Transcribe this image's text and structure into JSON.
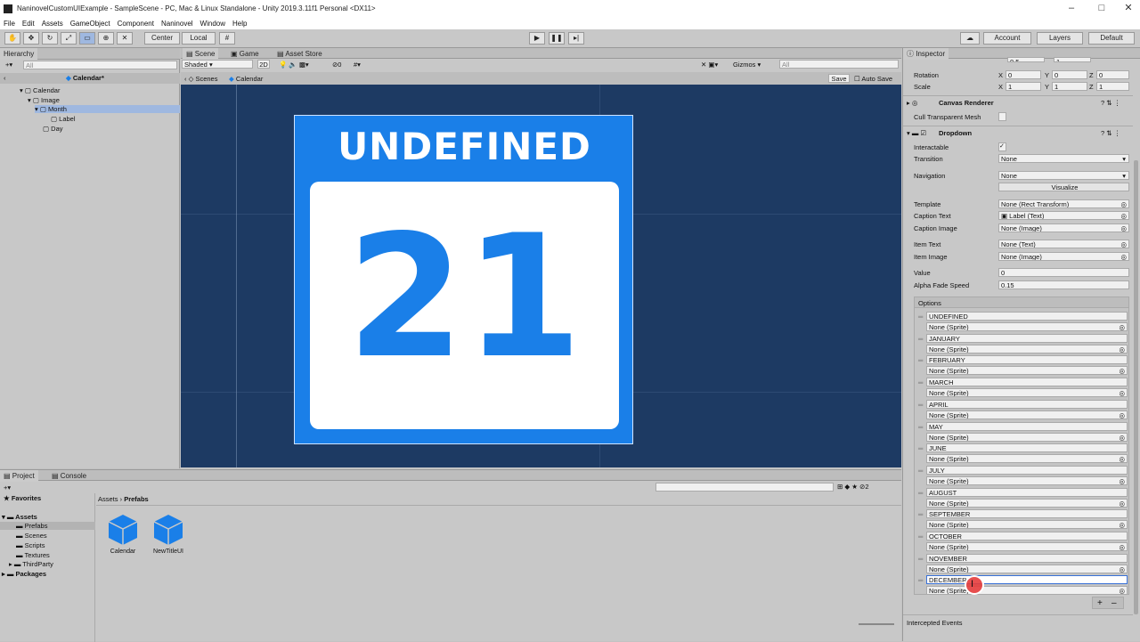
{
  "window": {
    "title": "NaninovelCustomUIExample - SampleScene - PC, Mac & Linux Standalone - Unity 2019.3.11f1 Personal <DX11>",
    "min": "–",
    "max": "□",
    "close": "✕"
  },
  "menu": [
    "File",
    "Edit",
    "Assets",
    "GameObject",
    "Component",
    "Naninovel",
    "Window",
    "Help"
  ],
  "toolbar": {
    "center": "Center",
    "local": "Local",
    "account": "Account",
    "layers": "Layers",
    "layout": "Default"
  },
  "hierarchy": {
    "tab": "Hierarchy",
    "search_placeholder": "All",
    "breadcrumb": "Calendar*",
    "items": [
      "Calendar",
      "Image",
      "Month",
      "Label",
      "Day"
    ]
  },
  "scene": {
    "tabs": [
      "Scene",
      "Game",
      "Asset Store"
    ],
    "shading": "Shaded",
    "mode2d": "2D",
    "gizmos": "Gizmos",
    "search_placeholder": "All",
    "hidden_count": "0",
    "crumb_scenes": "Scenes",
    "crumb_prefab": "Calendar",
    "save": "Save",
    "autosave": "Auto Save",
    "month": "UNDEFINED",
    "day": "21"
  },
  "project": {
    "tabs": [
      "Project",
      "Console"
    ],
    "favorites": "Favorites",
    "assets": "Assets",
    "folders": [
      "Prefabs",
      "Scenes",
      "Scripts",
      "Textures",
      "ThirdParty"
    ],
    "packages": "Packages",
    "path_root": "Assets",
    "path_leaf": "Prefabs",
    "hidden_count": "2",
    "files": [
      "Calendar",
      "NewTitleUI"
    ]
  },
  "inspector": {
    "tab": "Inspector",
    "rotation_label": "Rotation",
    "scale_label": "Scale",
    "rotation": [
      "0",
      "0",
      "0"
    ],
    "scale": [
      "1",
      "1",
      "1"
    ],
    "partial_pos": [
      "0.5",
      "1"
    ],
    "canvas_renderer": "Canvas Renderer",
    "cull_label": "Cull Transparent Mesh",
    "dropdown": "Dropdown",
    "props": {
      "interactable": "Interactable",
      "transition": "Transition",
      "transition_val": "None",
      "navigation": "Navigation",
      "navigation_val": "None",
      "visualize": "Visualize",
      "template": "Template",
      "template_val": "None (Rect Transform)",
      "caption_text": "Caption Text",
      "caption_text_val": "Label (Text)",
      "caption_image": "Caption Image",
      "caption_image_val": "None (Image)",
      "item_text": "Item Text",
      "item_text_val": "None (Text)",
      "item_image": "Item Image",
      "item_image_val": "None (Image)",
      "value": "Value",
      "value_val": "0",
      "alpha": "Alpha Fade Speed",
      "alpha_val": "0.15",
      "options": "Options"
    },
    "option_sprite": "None (Sprite)",
    "options": [
      "UNDEFINED",
      "JANUARY",
      "FEBRUARY",
      "MARCH",
      "APRIL",
      "MAY",
      "JUNE",
      "JULY",
      "AUGUST",
      "SEPTEMBER",
      "OCTOBER",
      "NOVEMBER",
      "DECEMBER"
    ],
    "add": "+",
    "remove": "–",
    "intercepted": "Intercepted Events"
  },
  "colors": {
    "scene_bg": "#1d3a63",
    "card_blue": "#1a7fe8",
    "selection": "#3a72d8"
  }
}
